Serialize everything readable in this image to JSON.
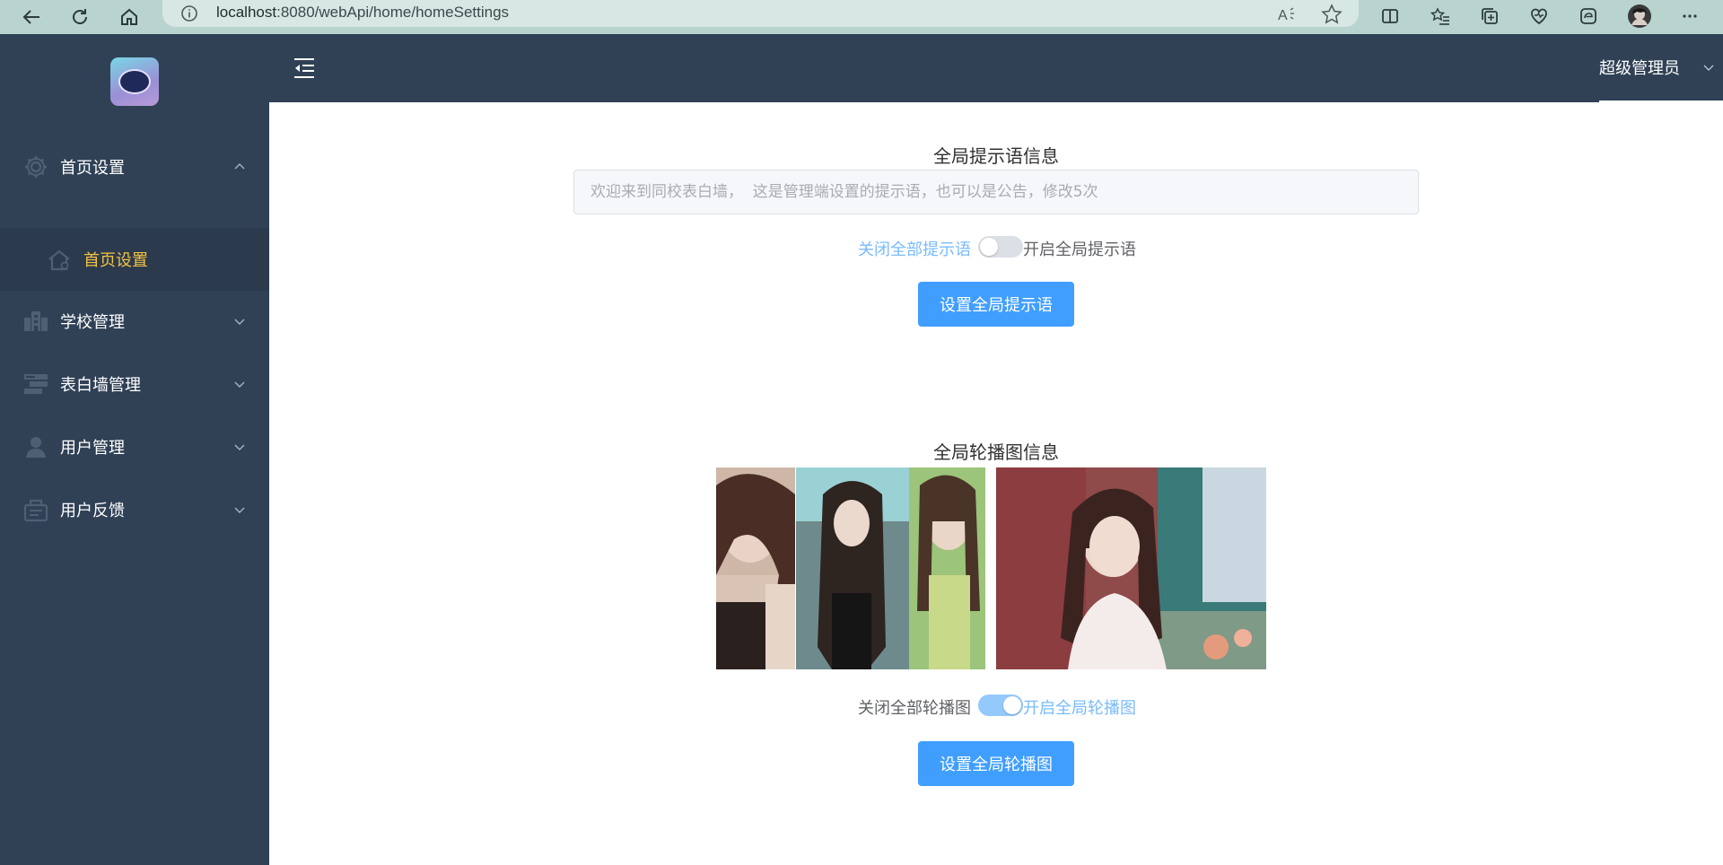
{
  "browser": {
    "url_host": "localhost",
    "url_rest": ":8080/webApi/home/homeSettings"
  },
  "sidebar": {
    "items": [
      {
        "label": "首页设置",
        "icon": "gear-icon",
        "expanded": true
      },
      {
        "label": "学校管理",
        "icon": "building-icon",
        "expanded": false
      },
      {
        "label": "表白墙管理",
        "icon": "wall-icon",
        "expanded": false
      },
      {
        "label": "用户管理",
        "icon": "user-icon",
        "expanded": false
      },
      {
        "label": "用户反馈",
        "icon": "feedback-icon",
        "expanded": false
      }
    ],
    "submenu": {
      "label": "首页设置",
      "icon": "home-icon"
    }
  },
  "header": {
    "user_name": "超级管理员"
  },
  "notice": {
    "title": "全局提示语信息",
    "placeholder": "欢迎来到同校表白墙，  这是管理端设置的提示语，也可以是公告，修改5次",
    "switch_off_label": "关闭全部提示语",
    "switch_on_label": "开启全局提示语",
    "switch_on": false,
    "button_label": "设置全局提示语"
  },
  "carousel": {
    "title": "全局轮播图信息",
    "switch_off_label": "关闭全部轮播图",
    "switch_on_label": "开启全局轮播图",
    "switch_on": true,
    "button_label": "设置全局轮播图"
  },
  "colors": {
    "sidebar_bg": "#304156",
    "submenu_active": "#f6c342",
    "primary": "#409eff",
    "switch_active_text": "#79bbff"
  }
}
